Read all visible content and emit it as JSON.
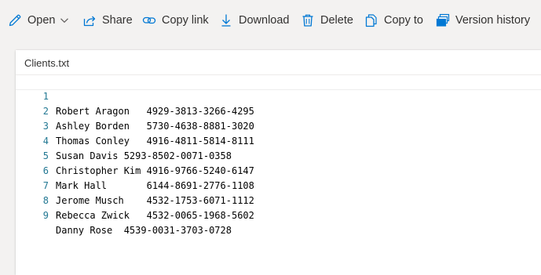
{
  "toolbar": {
    "open_label": "Open",
    "share_label": "Share",
    "copy_link_label": "Copy link",
    "download_label": "Download",
    "delete_label": "Delete",
    "copy_to_label": "Copy to",
    "version_history_label": "Version history",
    "icon_color": "#0078d4"
  },
  "file": {
    "name": "Clients.txt",
    "lines": [
      {
        "num": "1",
        "text": "Robert Aragon   4929-3813-3266-4295"
      },
      {
        "num": "2",
        "text": "Ashley Borden   5730-4638-8881-3020"
      },
      {
        "num": "3",
        "text": "Thomas Conley   4916-4811-5814-8111"
      },
      {
        "num": "4",
        "text": "Susan Davis 5293-8502-0071-0358"
      },
      {
        "num": "5",
        "text": "Christopher Kim 4916-9766-5240-6147"
      },
      {
        "num": "6",
        "text": "Mark Hall       6144-8691-2776-1108"
      },
      {
        "num": "7",
        "text": "Jerome Musch    4532-1753-6071-1112"
      },
      {
        "num": "8",
        "text": "Rebecca Zwick   4532-0065-1968-5602"
      },
      {
        "num": "9",
        "text": "Danny Rose  4539-0031-3703-0728"
      }
    ]
  }
}
